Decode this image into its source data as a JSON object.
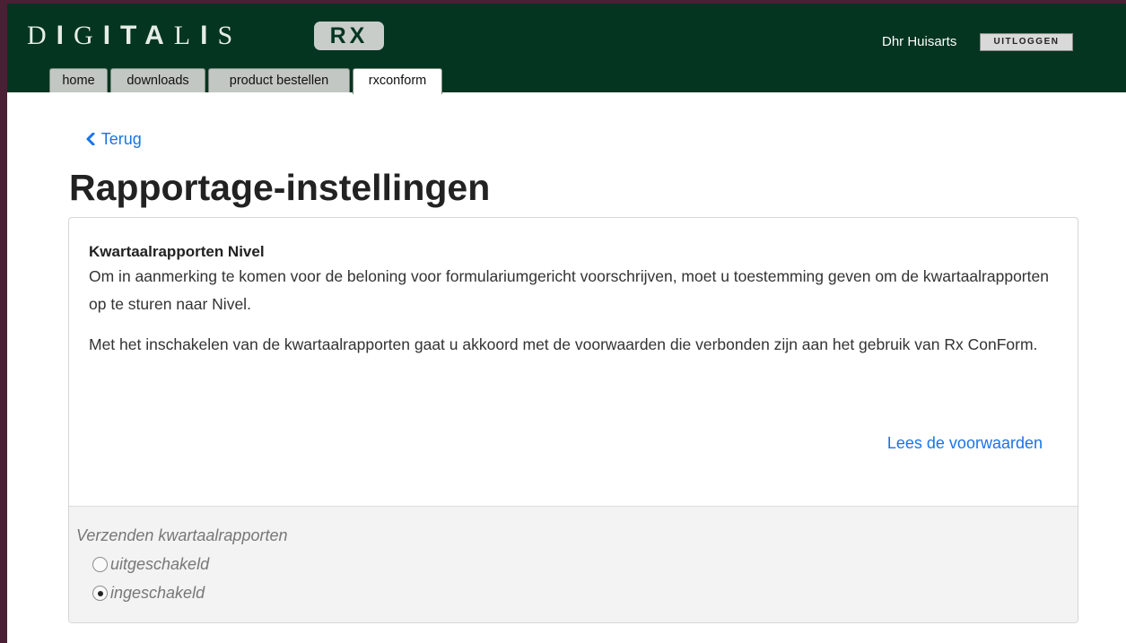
{
  "header": {
    "logo_part1": "D",
    "logo_part2": "I",
    "logo_part3": "G",
    "logo_part4": "I",
    "logo_part5": "TA",
    "logo_part6": "L",
    "logo_part7": "I",
    "logo_part8": "S",
    "logo_badge": "RX",
    "user_name": "Dhr Huisarts",
    "logout_label": "UITLOGGEN"
  },
  "tabs": [
    {
      "label": "home"
    },
    {
      "label": "downloads"
    },
    {
      "label": "product bestellen"
    },
    {
      "label": "rxconform",
      "active": true
    }
  ],
  "main": {
    "back_label": "Terug",
    "title": "Rapportage-instellingen",
    "panel": {
      "heading": "Kwartaalrapporten Nivel",
      "paragraph1": "Om in aanmerking te komen voor de beloning voor formulariumgericht voorschrijven, moet u toestemming geven om de kwartaalrapporten op te sturen naar Nivel.",
      "paragraph2": "Met het inschakelen van de kwartaalrapporten gaat u akkoord met de voorwaarden die verbonden zijn aan het gebruik van Rx ConForm.",
      "terms_link": "Lees de voorwaarden",
      "setting_label": "Verzenden kwartaalrapporten",
      "options": [
        {
          "label": "uitgeschakeld",
          "selected": false
        },
        {
          "label": "ingeschakeld",
          "selected": true
        }
      ]
    }
  },
  "colors": {
    "header_bg": "#033520",
    "frame": "#4a2035",
    "link": "#1a73e8"
  }
}
